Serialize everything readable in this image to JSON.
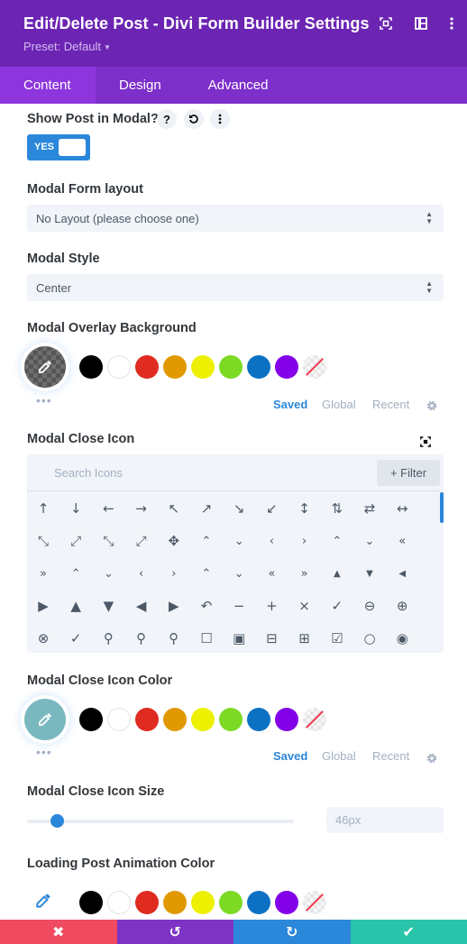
{
  "header": {
    "title": "Edit/Delete Post - Divi Form Builder Settings",
    "preset": "Preset: Default",
    "icons": [
      "expand-icon",
      "sidebar-layout-icon",
      "more-vertical-icon"
    ],
    "background": "#6c24b3"
  },
  "tabs": [
    {
      "label": "Content",
      "active": true
    },
    {
      "label": "Design",
      "active": false
    },
    {
      "label": "Advanced",
      "active": false
    }
  ],
  "show_post_modal": {
    "label": "Show Post in Modal?",
    "help": "?",
    "toggle_label": "YES",
    "toggle_value": true
  },
  "modal_form_layout": {
    "label": "Modal Form layout",
    "value": "No Layout (please choose one)"
  },
  "modal_style": {
    "label": "Modal Style",
    "value": "Center"
  },
  "palette": {
    "swatches": [
      {
        "name": "black",
        "color": "#000000"
      },
      {
        "name": "white",
        "color": "#ffffff"
      },
      {
        "name": "red",
        "color": "#e02b20"
      },
      {
        "name": "orange",
        "color": "#e09900"
      },
      {
        "name": "yellow",
        "color": "#edf000"
      },
      {
        "name": "green",
        "color": "#7cda24"
      },
      {
        "name": "blue",
        "color": "#0c71c3"
      },
      {
        "name": "purple",
        "color": "#8300e9"
      },
      {
        "name": "none",
        "color": "transparent"
      }
    ],
    "tabs": [
      "Saved",
      "Global",
      "Recent"
    ],
    "active_tab": "Saved",
    "more": "•••"
  },
  "modal_overlay_background": {
    "label": "Modal Overlay Background",
    "current_color": "rgba(0,0,0,0.6)"
  },
  "modal_close_icon": {
    "label": "Modal Close Icon",
    "search_placeholder": "Search Icons",
    "filter_label": "+ Filter",
    "icons": [
      "↑",
      "↓",
      "←",
      "→",
      "↖",
      "↗",
      "↘",
      "↙",
      "↕",
      "⇅",
      "⇄",
      "↔",
      "⤡",
      "⤢",
      "⤡",
      "⤢",
      "✥",
      "⌃",
      "⌄",
      "‹",
      "›",
      "⌃",
      "⌄",
      "«",
      "»",
      "⌃",
      "⌄",
      "‹",
      "›",
      "⌃",
      "⌄",
      "«",
      "»",
      "▲",
      "▼",
      "◀",
      "▶",
      "▲",
      "▼",
      "◀",
      "▶",
      "↶",
      "−",
      "+",
      "×",
      "✓",
      "⊖",
      "⊕",
      "⊗",
      "✓",
      "⚲",
      "⚲",
      "⚲",
      "☐",
      "▣",
      "⊟",
      "⊞",
      "☑",
      "○",
      "◉"
    ],
    "icon_names": [
      "arrow-up",
      "arrow-down",
      "arrow-left",
      "arrow-right",
      "arrow-up-left",
      "arrow-up-right",
      "arrow-down-right",
      "arrow-down-left",
      "arrow-up-down",
      "arrows-vertical",
      "arrows-exchange",
      "arrow-left-right",
      "resize-diagonal",
      "expand-diagonal",
      "shrink",
      "expand",
      "move",
      "chevron-up",
      "chevron-down",
      "chevron-left",
      "chevron-right",
      "double-chevron-up",
      "double-chevron-down",
      "double-chevron-left",
      "double-chevron-right",
      "circle-chevron-up",
      "circle-chevron-down",
      "circle-chevron-left",
      "circle-chevron-right",
      "circle-double-up",
      "circle-double-down",
      "circle-double-left",
      "circle-double-right",
      "triangle-up",
      "triangle-down",
      "triangle-left",
      "triangle-right",
      "circle-triangle-up",
      "circle-triangle-down",
      "circle-triangle-left",
      "circle-triangle-right",
      "undo",
      "minus",
      "plus",
      "close",
      "check",
      "circle-minus",
      "circle-plus",
      "circle-close",
      "circle-check",
      "zoom-out",
      "zoom-in",
      "search",
      "square",
      "square-filled",
      "square-minus",
      "square-plus",
      "checkbox",
      "circle",
      "radio-selected"
    ]
  },
  "modal_close_icon_color": {
    "label": "Modal Close Icon Color",
    "current_color": "#7ab8bf"
  },
  "modal_close_icon_size": {
    "label": "Modal Close Icon Size",
    "value": "46px",
    "slider_fraction": 0.11
  },
  "loading_animation_color": {
    "label": "Loading Post Animation Color"
  },
  "footer": {
    "buttons": [
      {
        "name": "discard",
        "icon": "✖",
        "color": "#ef4a5f"
      },
      {
        "name": "undo",
        "icon": "↺",
        "color": "#7e33c5"
      },
      {
        "name": "redo",
        "icon": "↻",
        "color": "#2b87da"
      },
      {
        "name": "save",
        "icon": "✔",
        "color": "#29c4a9"
      }
    ]
  }
}
